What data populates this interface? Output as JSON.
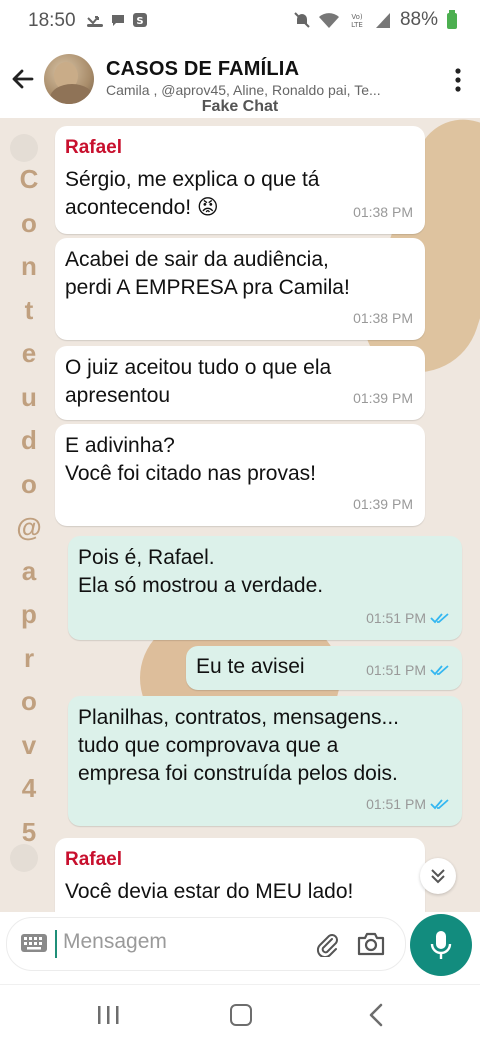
{
  "status_bar": {
    "time": "18:50",
    "battery": "88%"
  },
  "header": {
    "title": "CASOS DE FAMÍLIA",
    "subtitle": "Camila , @aprov45, Aline, Ronaldo pai, Te...",
    "overlay_label": "Fake Chat"
  },
  "watermark": [
    "C",
    "o",
    "n",
    "t",
    "e",
    "u",
    "d",
    "o",
    "@",
    "a",
    "p",
    "r",
    "o",
    "v",
    "4",
    "5"
  ],
  "messages": [
    {
      "direction": "in",
      "sender": "Rafael",
      "text": "Sérgio, me explica o que tá\nacontecendo! 😡",
      "time": "01:38 PM"
    },
    {
      "direction": "in",
      "sender": "",
      "text": "Acabei de sair da audiência,\nperdi A EMPRESA pra Camila!",
      "time": "01:38 PM"
    },
    {
      "direction": "in",
      "sender": "",
      "text": "O juiz aceitou tudo o que ela\napresentou",
      "time": "01:39 PM"
    },
    {
      "direction": "in",
      "sender": "",
      "text": "E adivinha?\nVocê foi citado nas provas!",
      "time": "01:39 PM"
    },
    {
      "direction": "out",
      "sender": "",
      "text": "Pois é, Rafael.\nEla só mostrou a verdade.",
      "time": "01:51 PM"
    },
    {
      "direction": "out",
      "sender": "",
      "text": "Eu te avisei",
      "time": "01:51 PM"
    },
    {
      "direction": "out",
      "sender": "",
      "text": "Planilhas, contratos, mensagens...\ntudo que comprovava que a\nempresa foi construída pelos dois.",
      "time": "01:51 PM"
    },
    {
      "direction": "in",
      "sender": "Rafael",
      "text": "Você devia estar do MEU lado!",
      "time": ""
    }
  ],
  "input": {
    "placeholder": "Mensagem"
  },
  "colors": {
    "accent": "#128c7e",
    "sender_name": "#c8102e",
    "outgoing_bubble": "#dcf1ea",
    "chat_background": "#efe7df"
  },
  "icons": [
    "back-arrow-icon",
    "more-vert-icon",
    "keyboard-icon",
    "attach-icon",
    "camera-icon",
    "mic-icon",
    "chevron-double-down-icon",
    "double-check-icon"
  ]
}
